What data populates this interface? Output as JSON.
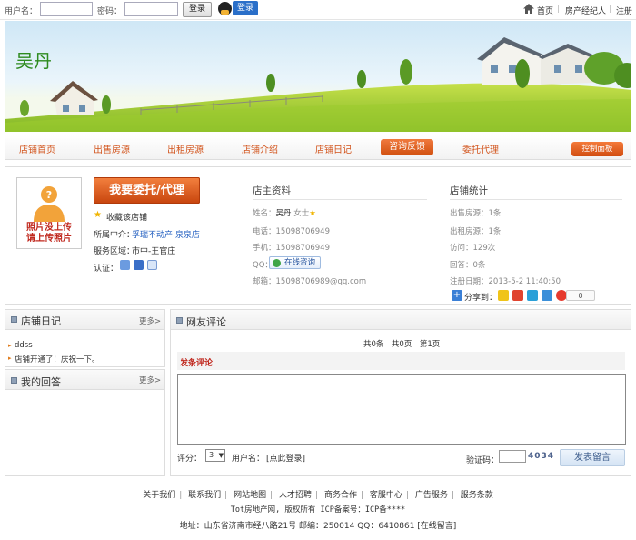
{
  "topbar": {
    "username_label": "用户名：",
    "password_label": "密码：",
    "login_button": "登录",
    "qq_login_button": "登录",
    "home_link": "首页",
    "agent_link": "房产经纪人",
    "register_link": "注册"
  },
  "banner": {
    "shop_name": "吴丹"
  },
  "nav": {
    "items": [
      "店铺首页",
      "出售房源",
      "出租房源",
      "店铺介绍",
      "店铺日记",
      "咨询反馈",
      "委托代理"
    ],
    "active": "咨询反馈",
    "control_panel": "控制面板"
  },
  "profile": {
    "photo_text_line1": "照片没上传",
    "photo_text_line2": "请上传照片",
    "entrust_button": "我要委托/代理",
    "favorite": "收藏该店铺",
    "agency_label": "所属中介：",
    "agency_value": "孚瑞不动产 泉泉店",
    "area_label": "服务区域：",
    "area_value": "市中-王官庄",
    "cert_label": "认证："
  },
  "owner": {
    "title": "店主资料",
    "name_label": "姓名：",
    "name": "吴丹",
    "gender": "女士",
    "phone_label": "电话：",
    "phone": "15098706949",
    "mobile_label": "手机：",
    "mobile": "15098706949",
    "qq_label": "QQ：",
    "consult_button": "在线咨询",
    "email_label": "邮箱：",
    "email": "15098706989@qq.com"
  },
  "stats": {
    "title": "店铺统计",
    "sale_label": "出售房源：",
    "sale": "1条",
    "rent_label": "出租房源：",
    "rent": "1条",
    "visits_label": "访问：",
    "visits": "129次",
    "answers_label": "回答：",
    "answers": "0条",
    "reg_label": "注册日期：",
    "reg_date": "2013-5-2 11:40:50",
    "share_label": "分享到：",
    "share_count": "0"
  },
  "diary": {
    "title": "店铺日记",
    "more": "更多>",
    "items": [
      "ddss",
      "店铺开通了！庆祝一下。"
    ]
  },
  "answers_box": {
    "title": "我的回答",
    "more": "更多>"
  },
  "comments": {
    "title": "网友评论",
    "pager": "共0条　共0页　第1页",
    "post_title": "发条评论",
    "score_label": "评分：",
    "score_value": "3",
    "user_label": "用户名：",
    "login_prompt": "[点此登录]",
    "captcha_label": "验证码：",
    "captcha_code": "4034",
    "submit": "发表留言"
  },
  "footer": {
    "links": [
      "关于我们",
      "联系我们",
      "网站地图",
      "人才招聘",
      "商务合作",
      "客服中心",
      "广告服务",
      "服务条款"
    ],
    "copyright": "Tot房地产网, 版权所有 ICP备案号：ICP备****",
    "address": "地址：山东省济南市经八路21号 邮编：250014 QQ：6410861 [在线留言]"
  }
}
